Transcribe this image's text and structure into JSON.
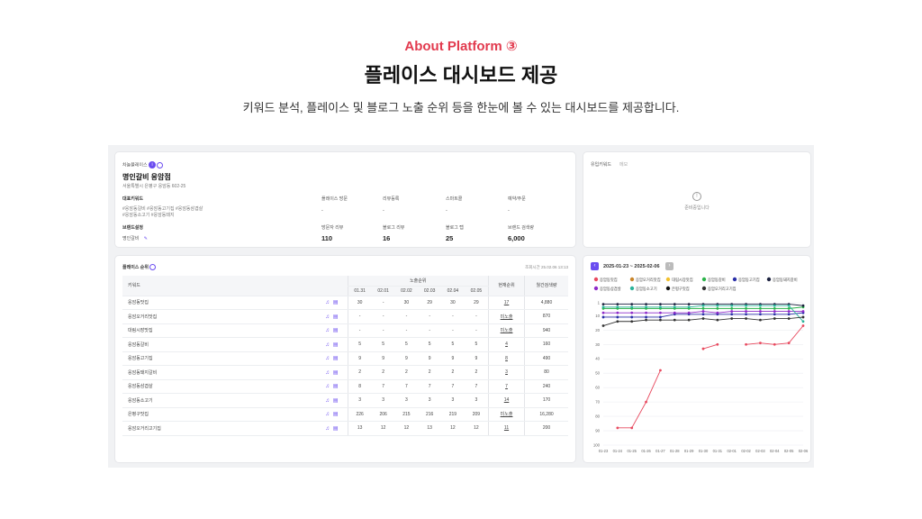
{
  "hero": {
    "eyebrow": "About Platform ③",
    "title": "플레이스 대시보드 제공",
    "description": "키워드 분석, 플레이스 및 블로그 노출 순위 등을 한눈에 볼 수 있는 대시보드를 제공합니다."
  },
  "place": {
    "section_label": "차놀플레이스",
    "name": "명인갈비 응암점",
    "address": "서울특별시 은평구 응암동 602-25",
    "rep_keywords_label": "대표키워드",
    "rep_keywords_1": "#응암동갈비 #응암동고기집 #응암동삼겹살",
    "rep_keywords_2": "#응암동소고기 #응암동돼지",
    "brand_label": "브랜드설정",
    "brand_value": "명인갈비",
    "stats_top": [
      {
        "label": "플레이스 방문",
        "value": "-"
      },
      {
        "label": "리뷰등록",
        "value": "-"
      },
      {
        "label": "스마트콜",
        "value": "-"
      },
      {
        "label": "예약/주문",
        "value": "-"
      }
    ],
    "stats_bottom": [
      {
        "label": "방문자 리뷰",
        "value": "110"
      },
      {
        "label": "블로그 리뷰",
        "value": "16"
      },
      {
        "label": "블로그 탭",
        "value": "25"
      },
      {
        "label": "브랜드 검색량",
        "value": "6,000"
      }
    ]
  },
  "keyword_panel": {
    "title": "유입키워드",
    "tab": "메모",
    "empty_text": "준비중입니다"
  },
  "rank": {
    "title": "플레이스 순위",
    "updated": "조회시간 25.02.06 13:13",
    "col_keyword": "키워드",
    "col_group": "노출순위",
    "dates": [
      "01.31",
      "02.01",
      "02.02",
      "02.03",
      "02.04",
      "02.05"
    ],
    "col_current": "현재순위",
    "col_volume": "월간검색량",
    "rows": [
      {
        "kw": "응암동맛집",
        "v": [
          "30",
          "-",
          "30",
          "29",
          "30",
          "29"
        ],
        "cur": "17",
        "vol": "4,880"
      },
      {
        "kw": "응암오거리맛집",
        "v": [
          "-",
          "-",
          "-",
          "-",
          "-",
          "-"
        ],
        "cur": "미노출",
        "vol": "870"
      },
      {
        "kw": "대림시장맛집",
        "v": [
          "-",
          "-",
          "-",
          "-",
          "-",
          "-"
        ],
        "cur": "미노출",
        "vol": "940"
      },
      {
        "kw": "응암동갈비",
        "v": [
          "5",
          "5",
          "5",
          "5",
          "5",
          "5"
        ],
        "cur": "4",
        "vol": "160"
      },
      {
        "kw": "응암동고기집",
        "v": [
          "9",
          "9",
          "9",
          "9",
          "9",
          "9"
        ],
        "cur": "8",
        "vol": "490"
      },
      {
        "kw": "응암동돼지갈비",
        "v": [
          "2",
          "2",
          "2",
          "2",
          "2",
          "2"
        ],
        "cur": "3",
        "vol": "80"
      },
      {
        "kw": "응암동삼겹살",
        "v": [
          "8",
          "7",
          "7",
          "7",
          "7",
          "7"
        ],
        "cur": "7",
        "vol": "240"
      },
      {
        "kw": "응암동소고기",
        "v": [
          "3",
          "3",
          "3",
          "3",
          "3",
          "3"
        ],
        "cur": "14",
        "vol": "170"
      },
      {
        "kw": "은평구맛집",
        "v": [
          "226",
          "206",
          "215",
          "216",
          "219",
          "209"
        ],
        "cur": "미노출",
        "vol": "16,280"
      },
      {
        "kw": "응암오거리고기집",
        "v": [
          "13",
          "12",
          "12",
          "13",
          "12",
          "12"
        ],
        "cur": "11",
        "vol": "200"
      }
    ]
  },
  "chart_panel": {
    "date_range": "2025-01-23 ~ 2025-02-06",
    "prev_icon": "chevron-left-icon",
    "next_icon": "chevron-right-icon"
  },
  "chart_data": {
    "type": "line",
    "x": [
      "01-23",
      "01-24",
      "01-25",
      "01-26",
      "01-27",
      "01-28",
      "01-29",
      "01-30",
      "01-31",
      "02-01",
      "02-02",
      "02-03",
      "02-04",
      "02-05",
      "02-06"
    ],
    "ylim": [
      100,
      1
    ],
    "yticks": [
      "1",
      "10",
      "20",
      "30",
      "40",
      "50",
      "60",
      "70",
      "80",
      "90",
      "100"
    ],
    "legend_position": "top",
    "series": [
      {
        "name": "응암동맛집",
        "color": "#e84a5f",
        "values": [
          null,
          88,
          88,
          70,
          48,
          null,
          null,
          33,
          30,
          null,
          30,
          29,
          30,
          29,
          17
        ]
      },
      {
        "name": "응암오거리맛집",
        "color": "#c9852b",
        "values": [
          null,
          null,
          null,
          null,
          null,
          null,
          null,
          null,
          null,
          null,
          null,
          null,
          null,
          null,
          null
        ]
      },
      {
        "name": "대림시장맛집",
        "color": "#f2c12e",
        "values": [
          null,
          null,
          null,
          null,
          null,
          null,
          null,
          null,
          null,
          null,
          null,
          null,
          null,
          null,
          null
        ]
      },
      {
        "name": "응암동갈비",
        "color": "#2bb34a",
        "values": [
          5,
          5,
          5,
          5,
          5,
          5,
          5,
          5,
          5,
          5,
          5,
          5,
          5,
          5,
          4
        ]
      },
      {
        "name": "응암동고기집",
        "color": "#2a2fa8",
        "values": [
          11,
          11,
          11,
          11,
          11,
          9,
          9,
          9,
          9,
          9,
          9,
          9,
          9,
          9,
          8
        ]
      },
      {
        "name": "응암동돼지갈비",
        "color": "#1d2340",
        "values": [
          2,
          2,
          2,
          2,
          2,
          2,
          2,
          2,
          2,
          2,
          2,
          2,
          2,
          2,
          3
        ]
      },
      {
        "name": "응암동삼겹살",
        "color": "#8e2bc9",
        "values": [
          8,
          8,
          8,
          8,
          8,
          8,
          8,
          7,
          8,
          7,
          7,
          7,
          7,
          7,
          7
        ]
      },
      {
        "name": "응암동소고기",
        "color": "#2bb39a",
        "values": [
          4,
          4,
          4,
          4,
          4,
          4,
          4,
          3,
          3,
          3,
          3,
          3,
          3,
          3,
          14
        ]
      },
      {
        "name": "은평구맛집",
        "color": "#111111",
        "values": [
          null,
          null,
          null,
          null,
          null,
          null,
          null,
          null,
          null,
          null,
          null,
          null,
          null,
          null,
          null
        ]
      },
      {
        "name": "응암오거리고기집",
        "color": "#333333",
        "values": [
          17,
          14,
          14,
          13,
          13,
          13,
          13,
          12,
          13,
          12,
          12,
          13,
          12,
          12,
          11
        ]
      }
    ]
  }
}
